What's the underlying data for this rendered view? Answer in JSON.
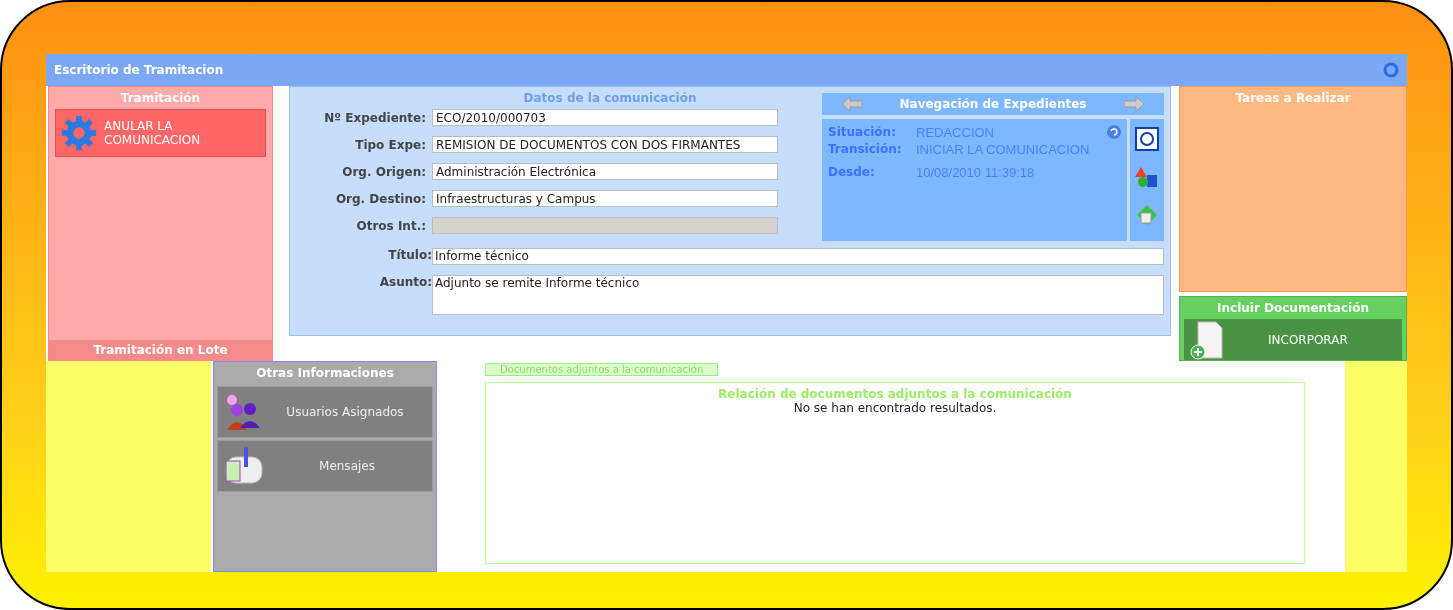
{
  "window": {
    "title": "Escritorio de Tramitacion"
  },
  "tramitacion": {
    "title": "Tramitación",
    "actions": [
      {
        "label": "ANULAR LA COMUNICACION"
      }
    ],
    "footer": "Tramitación en Lote"
  },
  "datos": {
    "title": "Datos de la comunicación",
    "fields": [
      {
        "label": "Nº Expediente:",
        "value": "ECO/2010/000703",
        "disabled": false
      },
      {
        "label": "Tipo Expe:",
        "value": "REMISION DE DOCUMENTOS CON DOS FIRMANTES",
        "disabled": false
      },
      {
        "label": "Org. Origen:",
        "value": "Administración Electrónica",
        "disabled": false
      },
      {
        "label": "Org. Destino:",
        "value": "Infraestructuras y Campus",
        "disabled": false
      },
      {
        "label": "Otros Int.:",
        "disabled": true
      }
    ],
    "titulo": {
      "label": "Título:",
      "value": "Informe técnico"
    },
    "asunto": {
      "label": "Asunto:",
      "value": "Adjunto se remite Informe técnico"
    }
  },
  "navegacion": {
    "title": "Navegación de Expedientes",
    "rows": [
      {
        "label": "Situación:",
        "value": "REDACCION"
      },
      {
        "label": "Transición:",
        "value": "INICIAR LA COMUNICACION"
      },
      {
        "label": "Desde:",
        "value": "10/08/2010 11:39:18"
      }
    ]
  },
  "tareas": {
    "title": "Tareas a Realizar"
  },
  "incluir": {
    "title": "Incluir Documentación",
    "action": "INCORPORAR"
  },
  "otras": {
    "title": "Otras Informaciones",
    "items": [
      {
        "kind": "users",
        "label": "Usuarios Asignados"
      },
      {
        "kind": "mail",
        "label": "Mensajes"
      }
    ]
  },
  "documentos": {
    "tab": "Documentos adjuntos a la comunicación",
    "heading": "Relación de documentos adjuntos a la comunicación",
    "empty": "No se han encontrado resultados."
  }
}
